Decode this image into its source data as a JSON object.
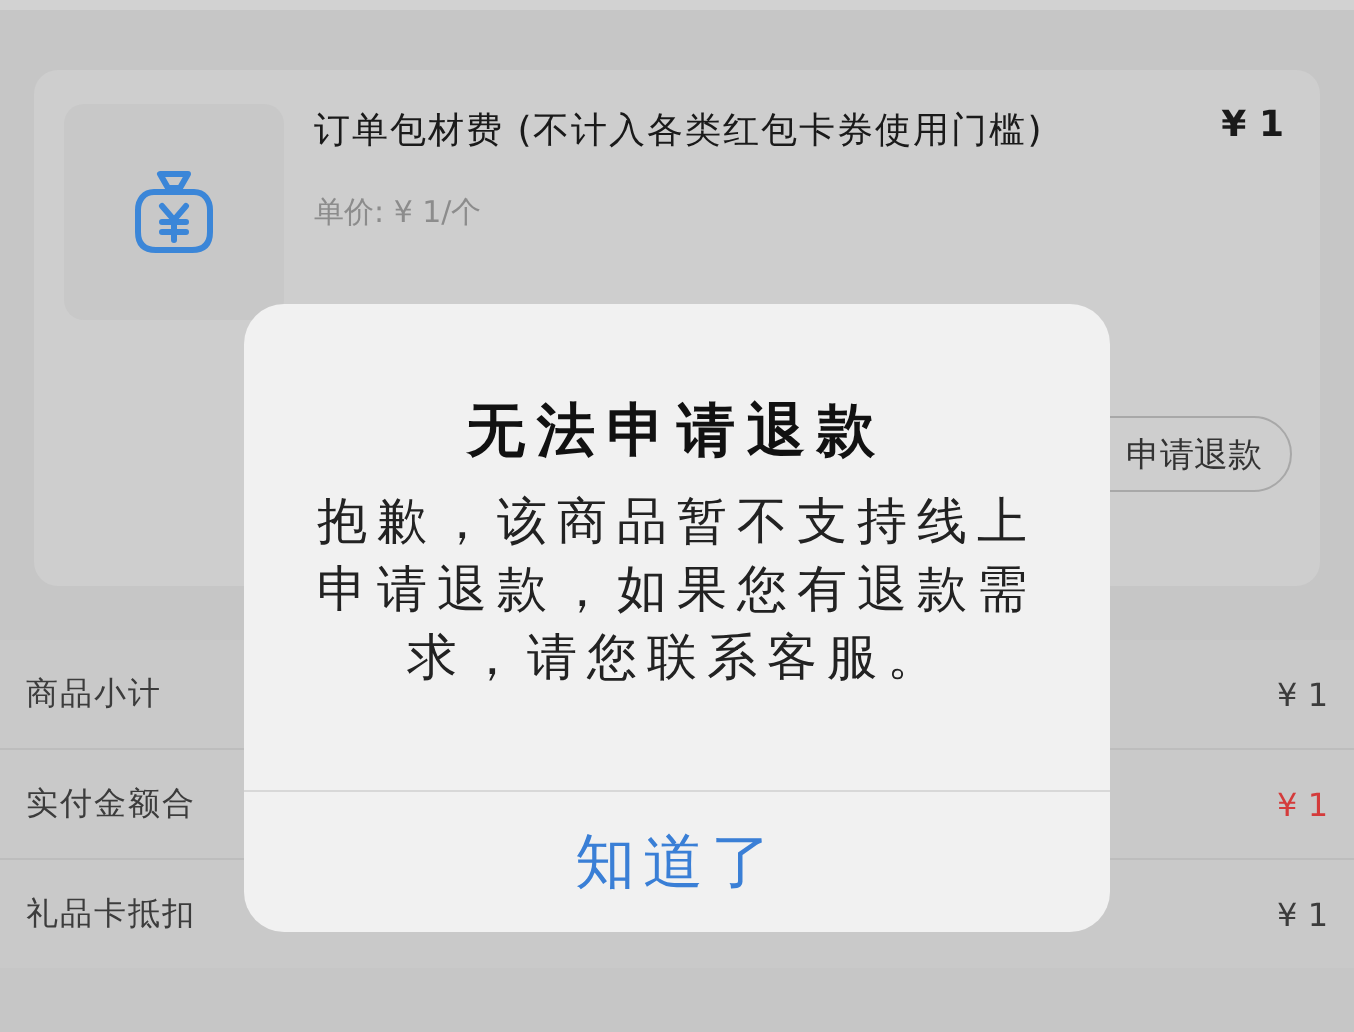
{
  "order_item": {
    "title": "订单包材费 (不计入各类红包卡券使用门槛)",
    "price": "¥ 1",
    "unit_price": "单价: ¥ 1/个",
    "refund_button": "申请退款"
  },
  "summary": {
    "rows": [
      {
        "label": "商品小计",
        "value": "¥ 1",
        "kind": "normal"
      },
      {
        "label": "实付金额合",
        "value": "¥ 1",
        "kind": "highlight"
      },
      {
        "label": "礼品卡抵扣",
        "value": "¥ 1",
        "kind": "normal"
      }
    ]
  },
  "dialog": {
    "title": "无法申请退款",
    "message": "抱歉，该商品暂不支持线上申请退款，如果您有退款需求，请您联系客服。",
    "button": "知道了"
  }
}
